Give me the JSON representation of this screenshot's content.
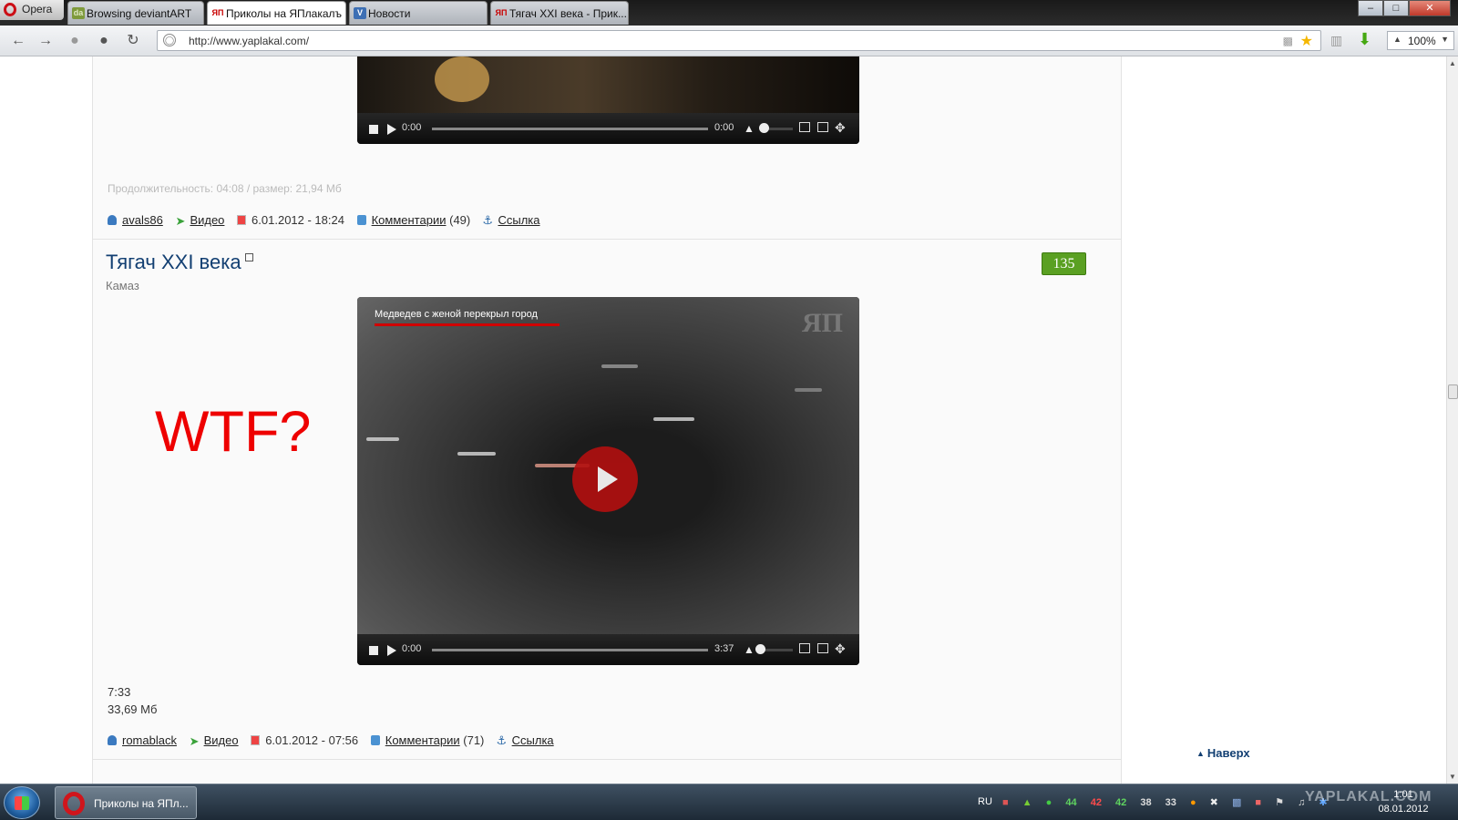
{
  "browser": {
    "opera_label": "Opera",
    "tabs": [
      {
        "title": "Browsing deviantART",
        "fav": "da",
        "active": false
      },
      {
        "title": "Приколы на ЯПлакалъ",
        "fav": "ЯП",
        "active": true
      },
      {
        "title": "Новости",
        "fav": "V",
        "active": false
      },
      {
        "title": "Тягач XXI века - Прик...",
        "fav": "ЯП",
        "active": false
      }
    ],
    "url": "http://www.yaplakal.com/",
    "zoom": "100%",
    "window_buttons": {
      "minimize": "–",
      "maximize": "□",
      "close": "✕"
    }
  },
  "post1": {
    "player": {
      "time_current": "0:00",
      "time_total": "0:00"
    },
    "meta": "Продолжительность: 04:08 / размер: 21,94 Мб",
    "author": "avals86",
    "category": "Видео",
    "date": "6.01.2012 - 18:24",
    "comments_label": "Комментарии",
    "comments_count": "(49)",
    "link_label": "Ссылка"
  },
  "post2": {
    "title": "Тягач XXI века",
    "subtitle": "Камаз",
    "rating": "135",
    "overlay_text": "WTF?",
    "video_caption": "Медведев с женой перекрыл город",
    "video_watermark": "ЯП",
    "player": {
      "time_current": "0:00",
      "time_total": "3:37"
    },
    "duration": "7:33",
    "size": "33,69 Мб",
    "author": "romablack",
    "category": "Видео",
    "date": "6.01.2012 - 07:56",
    "comments_label": "Комментарии",
    "comments_count": "(71)",
    "link_label": "Ссылка"
  },
  "page": {
    "to_top_label": "Наверх"
  },
  "taskbar": {
    "app_label": "Приколы на ЯПл...",
    "language": "RU",
    "tray_numbers": [
      {
        "value": "44",
        "color": "#5fd35f"
      },
      {
        "value": "42",
        "color": "#ff4b4b"
      },
      {
        "value": "42",
        "color": "#5fd35f"
      },
      {
        "value": "38",
        "color": "#dddddd"
      },
      {
        "value": "33",
        "color": "#dddddd"
      }
    ],
    "time": "1:01",
    "date": "08.01.2012",
    "watermark": "YAPLAKAL.COM"
  },
  "colors": {
    "accent_red": "#e00000",
    "rating_green": "#5aa022",
    "title_blue": "#123f72"
  }
}
